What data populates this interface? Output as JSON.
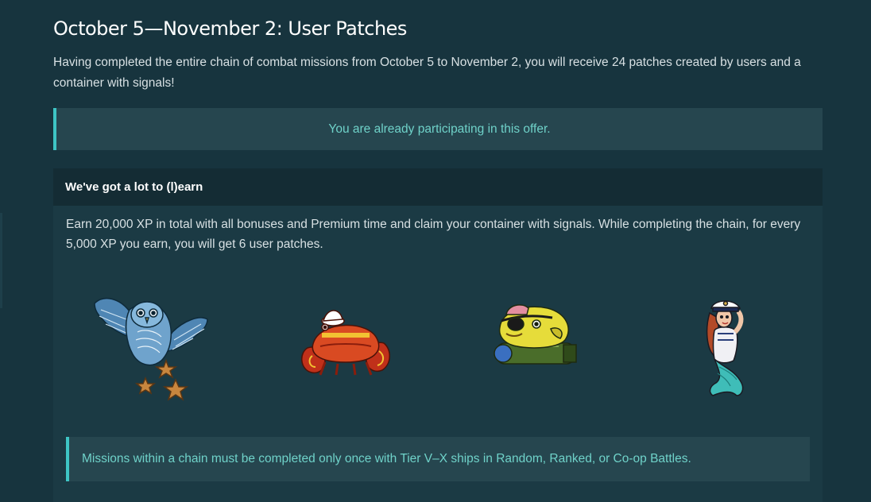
{
  "page": {
    "title": "October 5—November 2: User Patches",
    "intro": "Having completed the entire chain of combat missions from October 5 to November 2, you will receive 24 patches created by users and a container with signals!"
  },
  "notice": {
    "text": "You are already participating in this offer."
  },
  "card": {
    "header": "We've got a lot to (l)earn",
    "description": "Earn 20,000 XP in total with all bonuses and Premium time and claim your container with signals. While completing the chain, for every 5,000 XP you earn, you will get 6 user patches.",
    "patches": [
      {
        "icon": "owl-patch-icon"
      },
      {
        "icon": "crab-patch-icon"
      },
      {
        "icon": "pirate-fish-patch-icon"
      },
      {
        "icon": "mermaid-patch-icon"
      }
    ],
    "rules": "Missions within a chain must be completed only once with Tier V–X ships in Random, Ranked, or Co-op Battles."
  },
  "colors": {
    "background": "#17343e",
    "card": "#1b3a44",
    "card_header": "#142c34",
    "notice_bg": "#26464f",
    "accent": "#3ec5c5",
    "accent_text": "#6fd2c9"
  }
}
